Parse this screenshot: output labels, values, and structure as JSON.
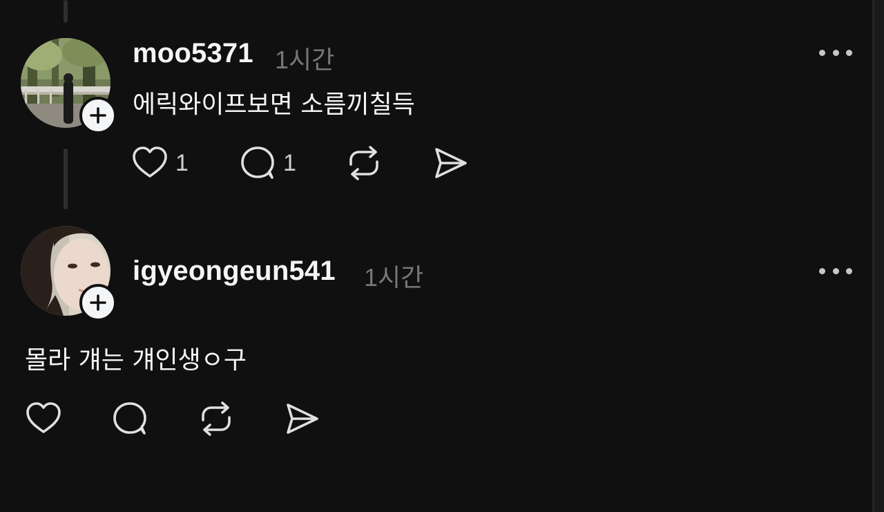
{
  "posts": [
    {
      "username": "moo5371",
      "time": "1시간",
      "text": "에릭와이프보면 소름끼칠득",
      "likes": "1",
      "replies": "1"
    },
    {
      "username": "igyeongeun541",
      "time": "1시간",
      "text": "몰라 걔는 걔인생ㅇ구"
    }
  ],
  "colors": {
    "background": "#101010",
    "text": "#f3f5f7",
    "muted": "#777777",
    "icon": "#e0e0e0"
  },
  "icons": [
    "plus-icon",
    "more-icon",
    "heart-icon",
    "comment-icon",
    "repost-icon",
    "share-icon"
  ]
}
